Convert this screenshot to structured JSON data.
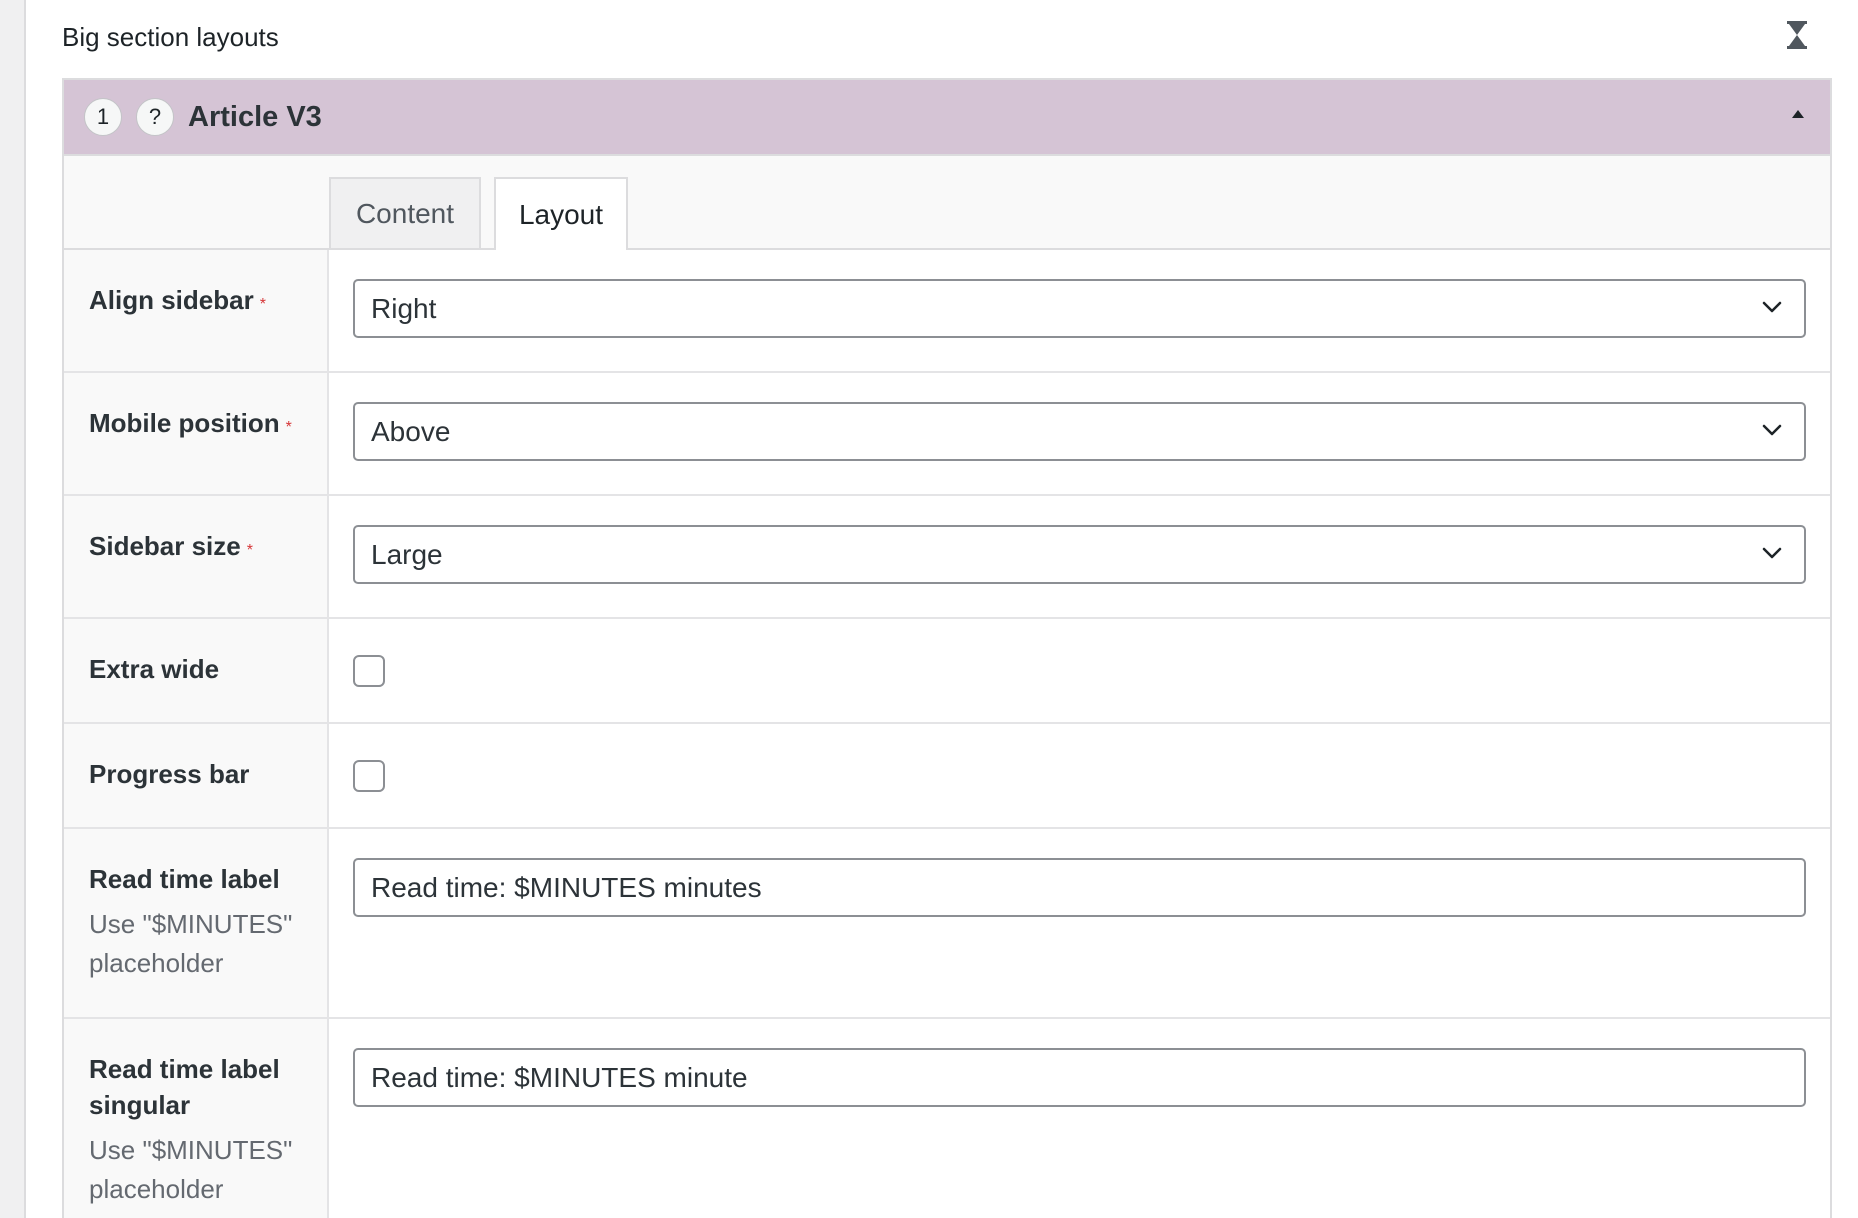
{
  "section": {
    "title": "Big section layouts"
  },
  "block": {
    "index": "1",
    "help": "?",
    "name": "Article V3"
  },
  "tabs": [
    {
      "label": "Content",
      "active": false
    },
    {
      "label": "Layout",
      "active": true
    }
  ],
  "fields": {
    "align_sidebar": {
      "label": "Align sidebar",
      "required": "*",
      "value": "Right"
    },
    "mobile_position": {
      "label": "Mobile position",
      "required": "*",
      "value": "Above"
    },
    "sidebar_size": {
      "label": "Sidebar size",
      "required": "*",
      "value": "Large"
    },
    "extra_wide": {
      "label": "Extra wide",
      "checked": false
    },
    "progress_bar": {
      "label": "Progress bar",
      "checked": false
    },
    "read_time_label": {
      "label": "Read time label",
      "description": "Use \"$MINUTES\" placeholder",
      "value": "Read time: $MINUTES minutes"
    },
    "read_time_label_singular": {
      "label": "Read time label singular",
      "description": "Use \"$MINUTES\" placeholder",
      "value": "Read time: $MINUTES minute"
    }
  },
  "colors": {
    "header_bg": "#d5c4d5",
    "required": "#d63638",
    "border": "#8c8f94"
  },
  "icons": {
    "collapse_all": "hourglass-icon",
    "toggle": "triangle-up-icon",
    "select_caret": "chevron-down-icon"
  }
}
